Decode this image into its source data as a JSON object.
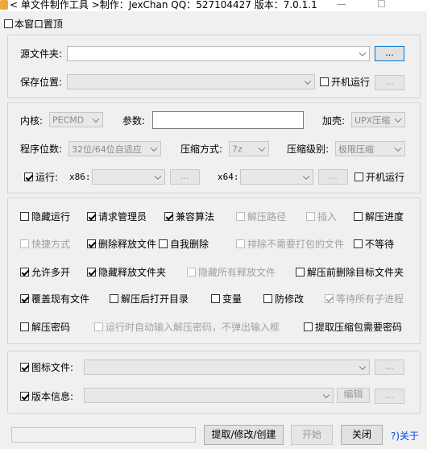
{
  "window": {
    "title": "< 单文件制作工具 >制作：JexChan  QQ：527104427  版本：7.0.1.1"
  },
  "top": {
    "pin_label": "本窗口置顶"
  },
  "source": {
    "folder_label": "源文件夹:",
    "browse_label": "...",
    "save_label": "保存位置:",
    "startup_label": "开机运行",
    "save_browse_label": "..."
  },
  "core": {
    "kernel_label": "内核:",
    "kernel_value": "PECMD",
    "param_label": "参数:",
    "shell_label": "加壳:",
    "shell_value": "UPX压缩",
    "bits_label": "程序位数:",
    "bits_value": "32位/64位自适应",
    "compress_label": "压缩方式:",
    "compress_value": "7z",
    "level_label": "压缩级别:",
    "level_value": "极限压缩",
    "run_label": "运行:",
    "x86_label": "x86:",
    "x86_browse": "...",
    "x64_label": "x64:",
    "x64_browse": "...",
    "run_startup_label": "开机运行"
  },
  "options": [
    {
      "label": "隐藏运行",
      "checked": false,
      "disabled": false
    },
    {
      "label": "请求管理员",
      "checked": true,
      "disabled": false
    },
    {
      "label": "兼容算法",
      "checked": true,
      "disabled": false
    },
    {
      "label": "解压路径",
      "checked": false,
      "disabled": true
    },
    {
      "label": "插入",
      "checked": false,
      "disabled": true
    },
    {
      "label": "解压进度",
      "checked": false,
      "disabled": false
    },
    {
      "label": "快捷方式",
      "checked": false,
      "disabled": true
    },
    {
      "label": "删除释放文件",
      "checked": true,
      "disabled": false
    },
    {
      "label": "自我删除",
      "checked": false,
      "disabled": false
    },
    {
      "label": "排除不需要打包的文件",
      "checked": false,
      "disabled": true
    },
    {
      "label": "不等待",
      "checked": false,
      "disabled": false
    },
    {
      "label": "允许多开",
      "checked": true,
      "disabled": false
    },
    {
      "label": "隐藏释放文件夹",
      "checked": true,
      "disabled": false
    },
    {
      "label": "隐藏所有释放文件",
      "checked": false,
      "disabled": true
    },
    {
      "label": "解压前删除目标文件夹",
      "checked": false,
      "disabled": false
    },
    {
      "label": "覆盖现有文件",
      "checked": true,
      "disabled": false
    },
    {
      "label": "解压后打开目录",
      "checked": false,
      "disabled": false
    },
    {
      "label": "变量",
      "checked": false,
      "disabled": false
    },
    {
      "label": "防修改",
      "checked": false,
      "disabled": false
    },
    {
      "label": "等待所有子进程",
      "checked": true,
      "disabled": true
    },
    {
      "label": "解压密码",
      "checked": false,
      "disabled": false
    },
    {
      "label": "运行时自动输入解压密码，不弹出输入框",
      "checked": false,
      "disabled": true
    },
    {
      "label": "提取压缩包需要密码",
      "checked": false,
      "disabled": false
    }
  ],
  "resources": {
    "icon_label": "图标文件:",
    "icon_browse": "...",
    "version_label": "版本信息:",
    "edit_label": "编辑",
    "version_browse": "..."
  },
  "bottom": {
    "extract_label": "提取/修改/创建",
    "start_label": "开始",
    "close_label": "关闭",
    "about_label": "?)关于"
  }
}
